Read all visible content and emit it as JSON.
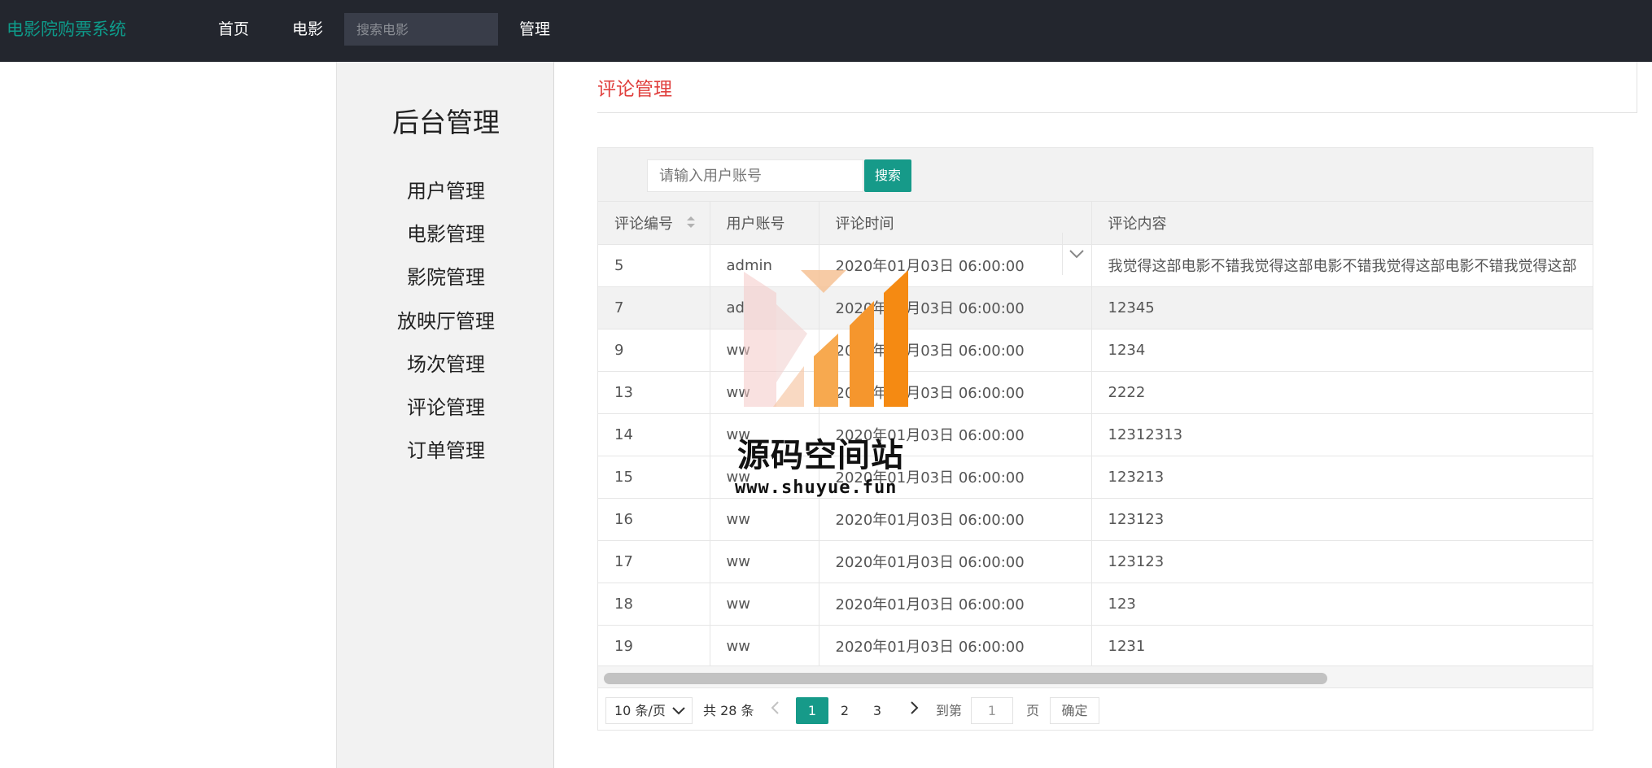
{
  "nav": {
    "brand": "电影院购票系统",
    "home": "首页",
    "movie": "电影",
    "search_placeholder": "搜索电影",
    "admin": "管理"
  },
  "sidebar": {
    "title": "后台管理",
    "items": [
      "用户管理",
      "电影管理",
      "影院管理",
      "放映厅管理",
      "场次管理",
      "评论管理",
      "订单管理"
    ]
  },
  "main": {
    "title": "评论管理",
    "search_placeholder": "请输入用户账号",
    "search_button": "搜索",
    "columns": [
      "评论编号",
      "用户账号",
      "评论时间",
      "评论内容"
    ],
    "rows": [
      [
        "5",
        "admin",
        "2020年01月03日 06:00:00",
        "我觉得这部电影不错我觉得这部电影不错我觉得这部电影不错我觉得这部"
      ],
      [
        "7",
        "ad",
        "2020年01月03日 06:00:00",
        "12345"
      ],
      [
        "9",
        "ww",
        "2020年01月03日 06:00:00",
        "1234"
      ],
      [
        "13",
        "ww",
        "2020年01月03日 06:00:00",
        "2222"
      ],
      [
        "14",
        "ww",
        "2020年01月03日 06:00:00",
        "12312313"
      ],
      [
        "15",
        "ww",
        "2020年01月03日 06:00:00",
        "123213"
      ],
      [
        "16",
        "ww",
        "2020年01月03日 06:00:00",
        "123123"
      ],
      [
        "17",
        "ww",
        "2020年01月03日 06:00:00",
        "123123"
      ],
      [
        "18",
        "ww",
        "2020年01月03日 06:00:00",
        "123"
      ],
      [
        "19",
        "ww",
        "2020年01月03日 06:00:00",
        "1231"
      ]
    ]
  },
  "pager": {
    "page_size": "10 条/页",
    "total": "共 28 条",
    "pages": [
      "1",
      "2",
      "3"
    ],
    "current": "1",
    "goto_label": "到第",
    "goto_value": "1",
    "page_unit": "页",
    "confirm": "确定"
  },
  "watermark": {
    "title": "源码空间站",
    "url": "www.shuyue.fun"
  },
  "colors": {
    "nav_bg": "#23262e",
    "brand": "#0e9b8a",
    "accent": "#169a89",
    "page_title": "#e0403e"
  }
}
